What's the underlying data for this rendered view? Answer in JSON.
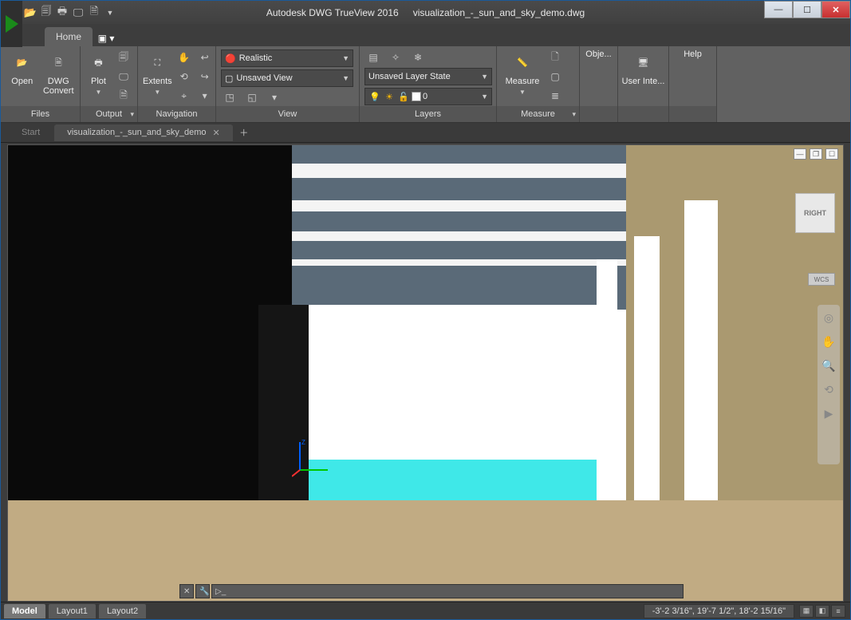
{
  "titlebar": {
    "app": "Autodesk DWG TrueView 2016",
    "file": "visualization_-_sun_and_sky_demo.dwg"
  },
  "tabs": {
    "home": "Home"
  },
  "ribbon": {
    "files": {
      "title": "Files",
      "open": "Open",
      "convert": "DWG Convert"
    },
    "output": {
      "title": "Output",
      "plot": "Plot"
    },
    "navigation": {
      "title": "Navigation",
      "extents": "Extents"
    },
    "view": {
      "title": "View",
      "visual_style": "Realistic",
      "named_view": "Unsaved View"
    },
    "layers": {
      "title": "Layers",
      "state": "Unsaved Layer State",
      "current": "0"
    },
    "measure": {
      "title": "Measure",
      "measure": "Measure"
    },
    "obj": {
      "label": "Obje..."
    },
    "ui": {
      "label": "User Inte..."
    },
    "help": {
      "label": "Help"
    }
  },
  "filetabs": {
    "start": "Start",
    "current": "visualization_-_sun_and_sky_demo"
  },
  "viewcube": {
    "face": "RIGHT",
    "wcs": "WCS"
  },
  "status": {
    "model": "Model",
    "layout1": "Layout1",
    "layout2": "Layout2",
    "coords": "-3'-2 3/16\", 19'-7 1/2\", 18'-2 15/16\""
  }
}
